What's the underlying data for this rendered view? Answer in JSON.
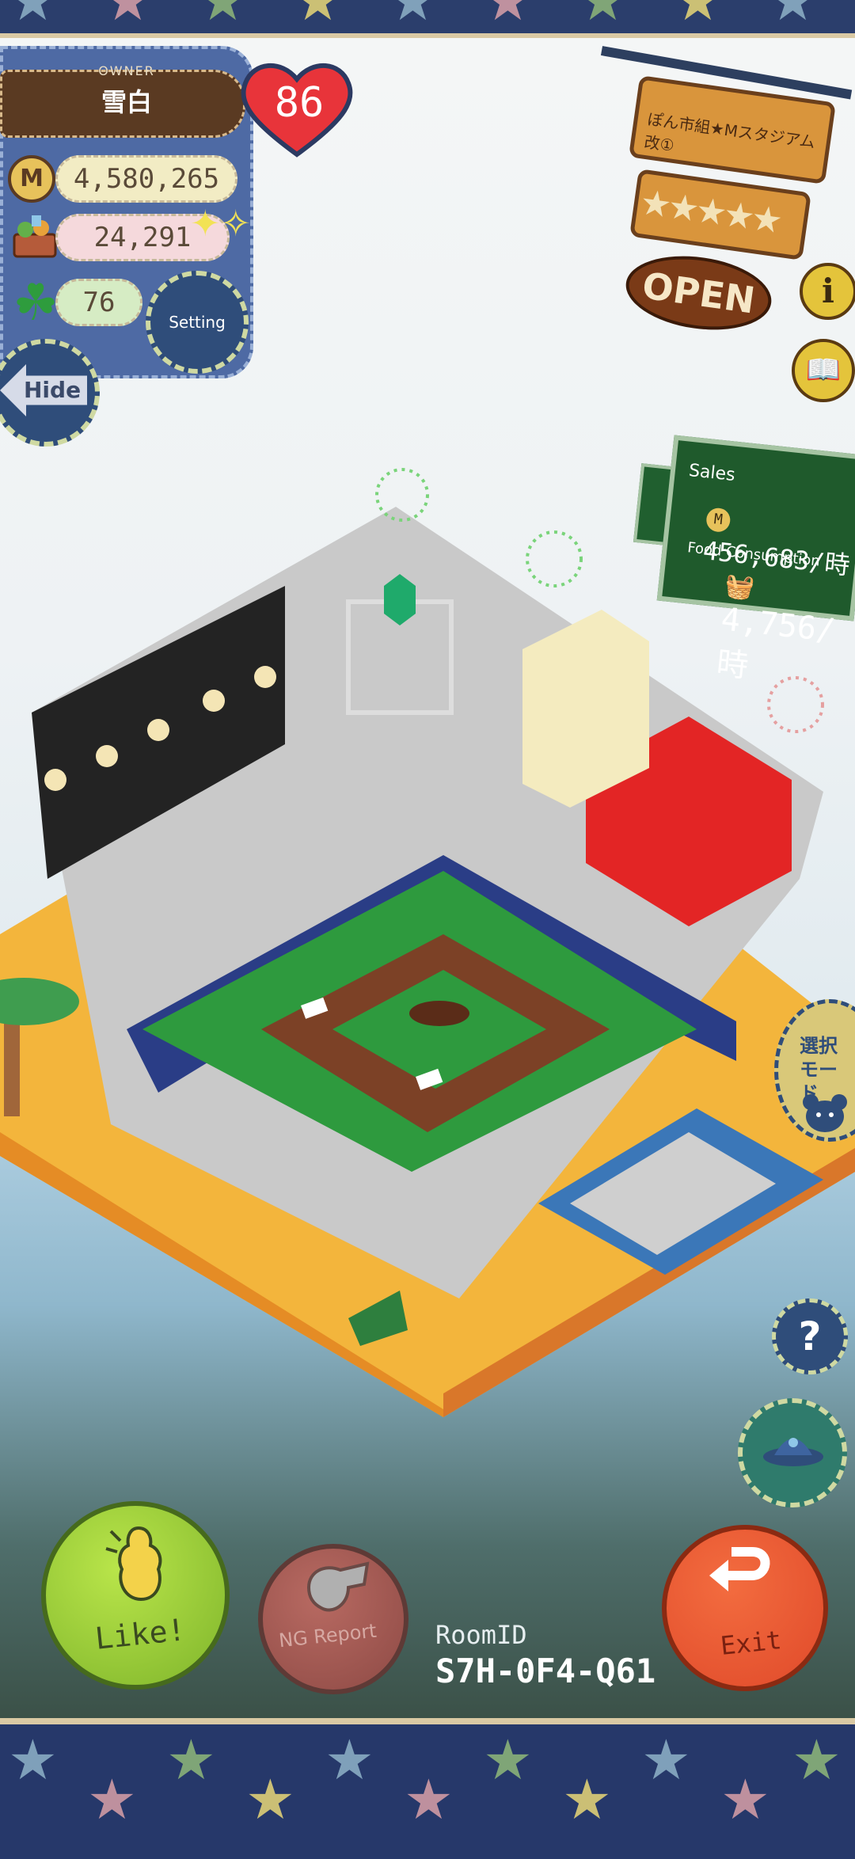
{
  "owner": {
    "label": "OWNER",
    "name": "雪白",
    "level": "86",
    "money": "4,580,265",
    "food": "24,291",
    "clover": "76",
    "setting_label": "Setting",
    "hide_label": "Hide",
    "coin_symbol": "M"
  },
  "shop_sign": {
    "name": "ぽん市組★Mスタジアム改①",
    "rating": "★★★★★",
    "status": "OPEN",
    "info_symbol": "i"
  },
  "sales_panel": {
    "sales_label": "Sales",
    "sales_value": "456,683/時",
    "food_label": "Food Consumption",
    "food_value": "4,756/時",
    "coin_symbol": "M"
  },
  "side_buttons": {
    "mode_label": "選択モード",
    "help_symbol": "?"
  },
  "bottom_bar": {
    "like_label": "Like!",
    "ng_report_label": "NG Report",
    "room_id_label": "RoomID",
    "room_id_value": "S7H-0F4-Q61",
    "exit_label": "Exit"
  },
  "icons": [
    "coin-icon",
    "food-basket-icon",
    "clover-icon",
    "sparkle-icon",
    "gear-icon",
    "back-arrow-icon",
    "info-icon",
    "book-icon",
    "whistle-icon",
    "return-arrow-icon",
    "bear-icon",
    "ufo-hat-icon",
    "hand-icon",
    "question-icon"
  ],
  "colors": {
    "panel_blue": "#4e6aa4",
    "sign_brown": "#d9953c",
    "sales_green": "#1f5a2c",
    "like_green": "#9ccc3a",
    "ng_red": "#a0564f",
    "exit_orange": "#e95a33"
  }
}
